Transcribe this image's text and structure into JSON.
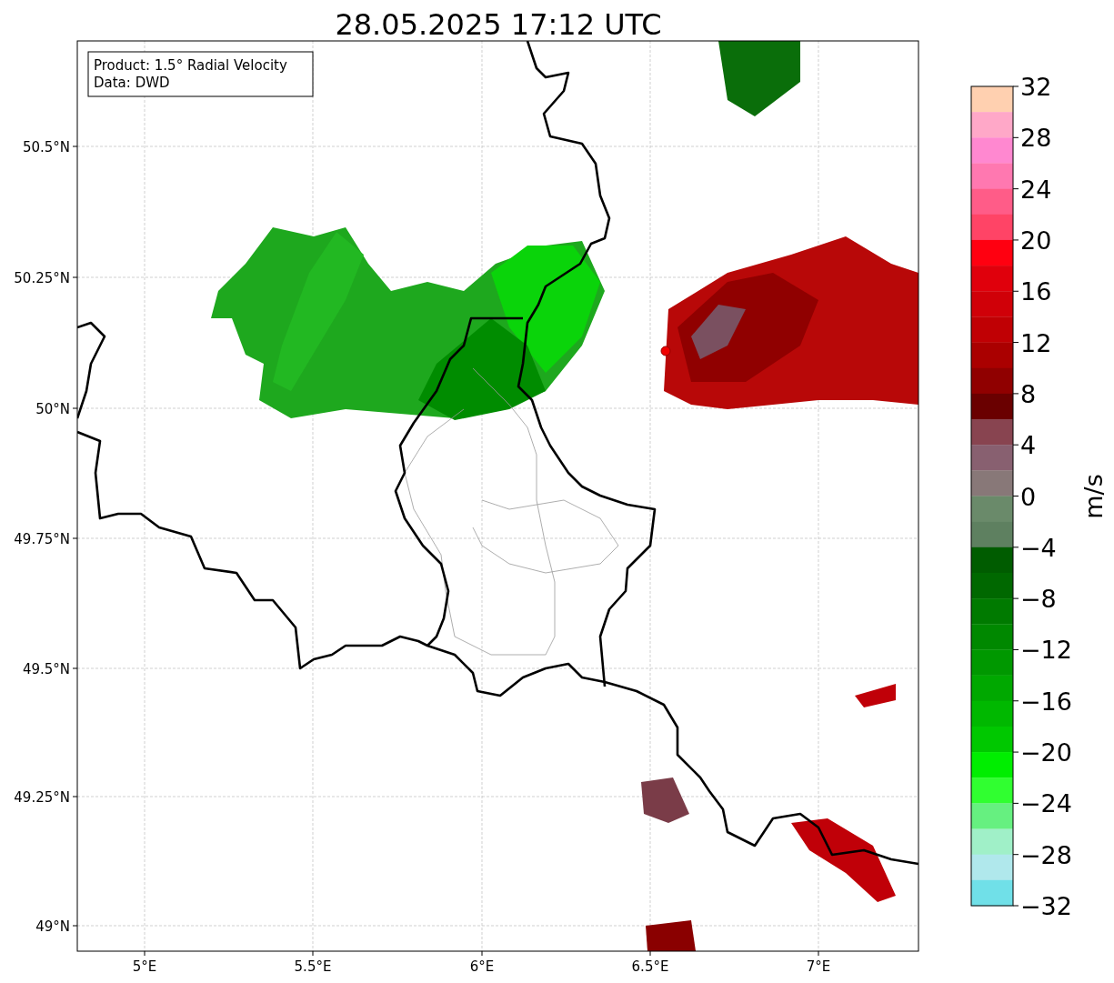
{
  "title": "28.05.2025 17:12 UTC",
  "annotation": [
    "Product: 1.5° Radial Velocity",
    "Data: DWD"
  ],
  "y_ticks": [
    "50.5°N",
    "50.25°N",
    "50°N",
    "49.75°N",
    "49.5°N",
    "49.25°N",
    "49°N"
  ],
  "x_ticks": [
    "5°E",
    "5.5°E",
    "6°E",
    "6.5°E",
    "7°E"
  ],
  "colorbar": {
    "label": "m/s",
    "ticks": [
      "32",
      "28",
      "24",
      "20",
      "16",
      "12",
      "8",
      "4",
      "0",
      "−4",
      "−8",
      "−12",
      "−16",
      "−20",
      "−24",
      "−28",
      "−32"
    ],
    "segments": [
      {
        "color": "#ffd0b0"
      },
      {
        "color": "#ffa8c8"
      },
      {
        "color": "#ff88d0"
      },
      {
        "color": "#ff78b0"
      },
      {
        "color": "#ff5c88"
      },
      {
        "color": "#ff4466"
      },
      {
        "color": "#ff0010"
      },
      {
        "color": "#e0000c"
      },
      {
        "color": "#d00008"
      },
      {
        "color": "#c00004"
      },
      {
        "color": "#aa0000"
      },
      {
        "color": "#900000"
      },
      {
        "color": "#6a0000"
      },
      {
        "color": "#884450"
      },
      {
        "color": "#886070"
      },
      {
        "color": "#887878"
      },
      {
        "color": "#6a8a6a"
      },
      {
        "color": "#5e8060"
      },
      {
        "color": "#005c00"
      },
      {
        "color": "#006800"
      },
      {
        "color": "#007a00"
      },
      {
        "color": "#008800"
      },
      {
        "color": "#009800"
      },
      {
        "color": "#00a800"
      },
      {
        "color": "#00b800"
      },
      {
        "color": "#00c800"
      },
      {
        "color": "#00ee00"
      },
      {
        "color": "#30ff30"
      },
      {
        "color": "#66f080"
      },
      {
        "color": "#a0f0c8"
      },
      {
        "color": "#b0e8ec"
      },
      {
        "color": "#70e0e8"
      }
    ]
  }
}
